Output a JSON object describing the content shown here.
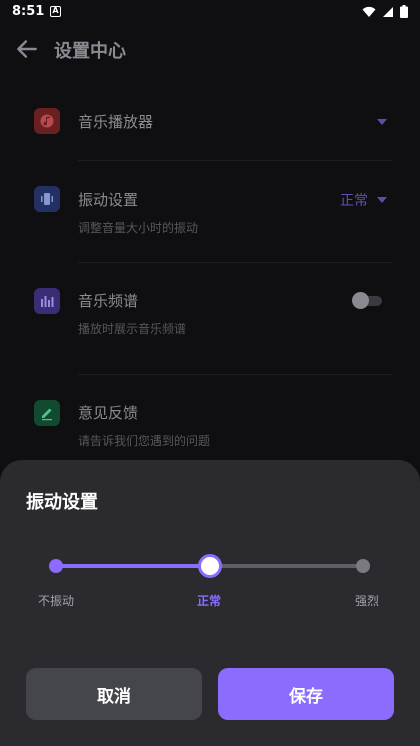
{
  "status_bar": {
    "time": "8:51",
    "notification_badge": "A"
  },
  "app_bar": {
    "title": "设置中心"
  },
  "settings": [
    {
      "label": "音乐播放器",
      "subtitle": "",
      "icon": "music-icon",
      "color": "#e04444"
    },
    {
      "label": "振动设置",
      "subtitle": "调整音量大小时的振动",
      "value": "正常",
      "icon": "vibration-icon",
      "color": "#3d5bd6"
    },
    {
      "label": "音乐频谱",
      "subtitle": "播放时展示音乐频谱",
      "icon": "spectrum-icon",
      "color": "#7a5cf0",
      "toggle_on": false
    },
    {
      "label": "意见反馈",
      "subtitle": "请告诉我们您遇到的问题",
      "icon": "edit-icon",
      "color": "#1eb06a"
    }
  ],
  "sheet": {
    "title": "振动设置",
    "levels": [
      "不振动",
      "正常",
      "强烈"
    ],
    "selected_index": 1,
    "accent": "#8b6cff",
    "cancel_label": "取消",
    "save_label": "保存"
  }
}
